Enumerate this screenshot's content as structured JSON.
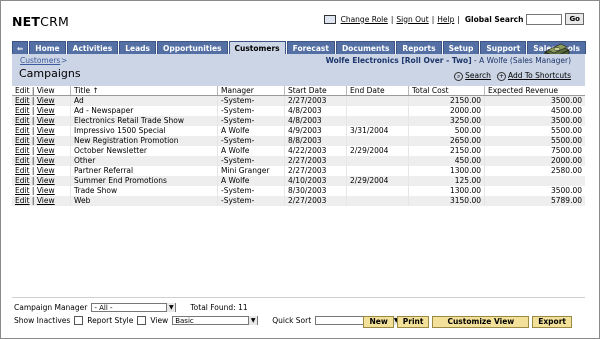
{
  "app": {
    "logo_bold": "NET",
    "logo_rest": "CRM"
  },
  "topbar": {
    "change_role": "Change Role",
    "sign_out": "Sign Out",
    "help": "Help",
    "global_search_label": "Global Search",
    "search_value": "",
    "go": "Go",
    "sep": "|"
  },
  "tabs": [
    "⇐",
    "Home",
    "Activities",
    "Leads",
    "Opportunities",
    "Customers",
    "Forecast",
    "Documents",
    "Reports",
    "Setup",
    "Support",
    "Sales Tools"
  ],
  "header": {
    "breadcrumb": "Customers",
    "breadcrumb_arrow": ">",
    "account_name": "Wolfe Electronics [Roll Over - Two]",
    "account_user": " - A Wolfe (Sales Manager)",
    "title": "Campaigns",
    "search_link": "Search",
    "add_shortcuts": "Add To Shortcuts"
  },
  "table": {
    "columns": [
      "Edit | View",
      "Title ↑",
      "Manager",
      "Start Date",
      "End Date",
      "Total Cost",
      "Expected Revenue"
    ],
    "edit": "Edit",
    "view": "View",
    "pipe": "|",
    "rows": [
      {
        "title": "Ad",
        "manager": "-System-",
        "start": "2/27/2003",
        "end": "",
        "cost": "2150.00",
        "revenue": "3500.00"
      },
      {
        "title": "Ad - Newspaper",
        "manager": "-System-",
        "start": "4/8/2003",
        "end": "",
        "cost": "2000.00",
        "revenue": "4500.00"
      },
      {
        "title": "Electronics Retail Trade Show",
        "manager": "-System-",
        "start": "4/8/2003",
        "end": "",
        "cost": "3250.00",
        "revenue": "3500.00"
      },
      {
        "title": "Impressivo 1500 Special",
        "manager": "A Wolfe",
        "start": "4/9/2003",
        "end": "3/31/2004",
        "cost": "500.00",
        "revenue": "5500.00"
      },
      {
        "title": "New Registration Promotion",
        "manager": "-System-",
        "start": "8/8/2003",
        "end": "",
        "cost": "2650.00",
        "revenue": "5500.00"
      },
      {
        "title": "October Newsletter",
        "manager": "A Wolfe",
        "start": "4/22/2003",
        "end": "2/29/2004",
        "cost": "2150.00",
        "revenue": "7500.00"
      },
      {
        "title": "Other",
        "manager": "-System-",
        "start": "2/27/2003",
        "end": "",
        "cost": "450.00",
        "revenue": "2000.00"
      },
      {
        "title": "Partner Referral",
        "manager": "Mini Granger",
        "start": "2/27/2003",
        "end": "",
        "cost": "1300.00",
        "revenue": "2580.00"
      },
      {
        "title": "Summer End Promotions",
        "manager": "A Wolfe",
        "start": "4/10/2003",
        "end": "2/29/2004",
        "cost": "125.00",
        "revenue": ""
      },
      {
        "title": "Trade Show",
        "manager": "-System-",
        "start": "8/30/2003",
        "end": "",
        "cost": "1300.00",
        "revenue": "3500.00"
      },
      {
        "title": "Web",
        "manager": "-System-",
        "start": "2/27/2003",
        "end": "",
        "cost": "3150.00",
        "revenue": "5789.00"
      }
    ]
  },
  "footer": {
    "manager_label": "Campaign Manager",
    "manager_value": "- All -",
    "total_label": "Total Found: 11",
    "show_inactives": "Show Inactives",
    "report_style": "Report Style",
    "view_label": "View",
    "view_value": "Basic",
    "quick_sort": "Quick Sort",
    "quick_sort_value": "",
    "new": "New",
    "print": "Print",
    "customize": "Customize View",
    "export": "Export"
  }
}
